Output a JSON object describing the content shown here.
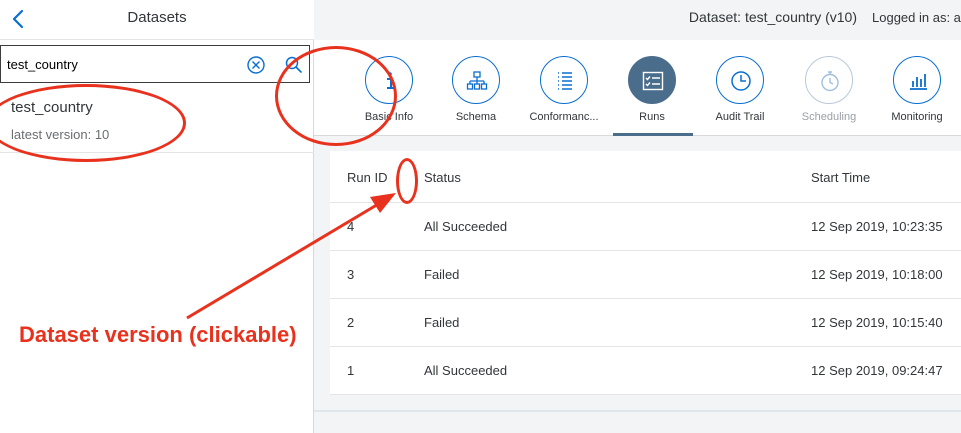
{
  "left_pane": {
    "title": "Datasets",
    "search": {
      "value": "test_country"
    },
    "items": [
      {
        "title": "test_country",
        "subtitle": "latest version: 10"
      }
    ]
  },
  "header": {
    "dataset_label": "Dataset: test_country (v10)",
    "logged_in_label": "Logged in as: a"
  },
  "tabs": [
    {
      "label": "Basic Info",
      "icon": "info-icon",
      "state": "normal"
    },
    {
      "label": "Schema",
      "icon": "hierarchy-icon",
      "state": "normal"
    },
    {
      "label": "Conformanc...",
      "icon": "list-icon",
      "state": "normal"
    },
    {
      "label": "Runs",
      "icon": "checklist-icon",
      "state": "active"
    },
    {
      "label": "Audit Trail",
      "icon": "clock-icon",
      "state": "normal"
    },
    {
      "label": "Scheduling",
      "icon": "stopwatch-icon",
      "state": "disabled"
    },
    {
      "label": "Monitoring",
      "icon": "bar-chart-icon",
      "state": "normal"
    }
  ],
  "runs_table": {
    "columns": [
      "Run ID",
      "Status",
      "Start Time"
    ],
    "rows": [
      {
        "run_id": "4",
        "status": "All Succeeded",
        "start_time": "12 Sep 2019, 10:23:35"
      },
      {
        "run_id": "3",
        "status": "Failed",
        "start_time": "12 Sep 2019, 10:18:00"
      },
      {
        "run_id": "2",
        "status": "Failed",
        "start_time": "12 Sep 2019, 10:15:40"
      },
      {
        "run_id": "1",
        "status": "All Succeeded",
        "start_time": "12 Sep 2019, 09:24:47"
      }
    ]
  },
  "annotation": {
    "text": "Dataset version (clickable)",
    "color": "#e8321e"
  },
  "colors": {
    "accent": "#0a6ed1",
    "active_tab": "#4a6d8c",
    "annotation": "#e8321e"
  }
}
